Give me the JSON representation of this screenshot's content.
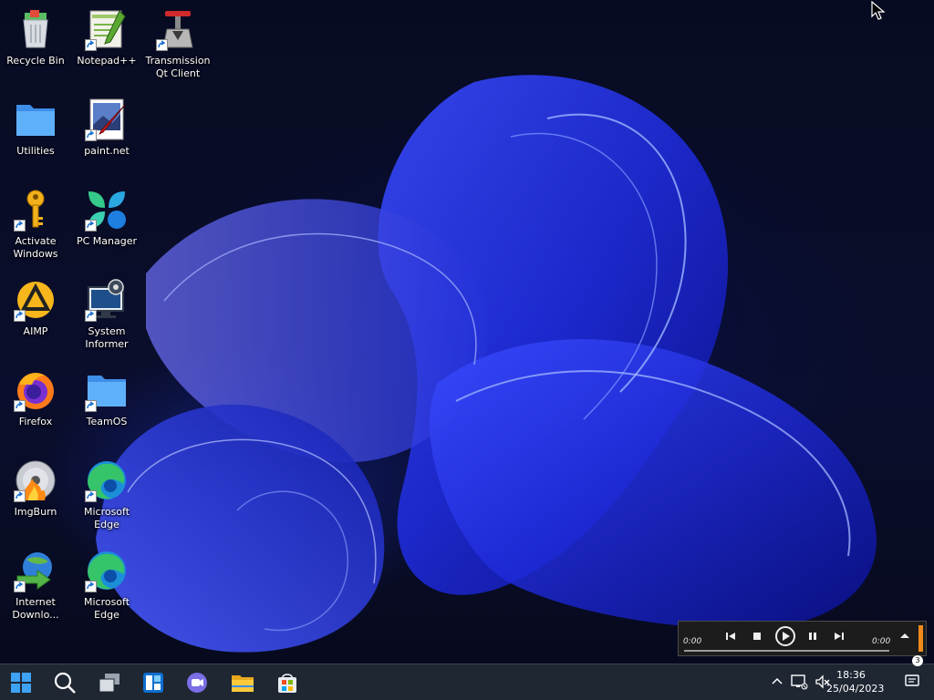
{
  "desktop_icons": [
    {
      "id": "recycle-bin",
      "label": "Recycle Bin",
      "icon": "recycle-bin-icon",
      "shortcut": false
    },
    {
      "id": "notepadpp",
      "label": "Notepad++",
      "icon": "notepadpp-icon",
      "shortcut": true
    },
    {
      "id": "transmission",
      "label": "Transmission\nQt Client",
      "icon": "transmission-icon",
      "shortcut": true
    },
    {
      "id": "utilities",
      "label": "Utilities",
      "icon": "folder-icon",
      "shortcut": false
    },
    {
      "id": "paintnet",
      "label": "paint.net",
      "icon": "paintnet-icon",
      "shortcut": true
    },
    {
      "id": "activate-windows",
      "label": "Activate\nWindows",
      "icon": "key-icon",
      "shortcut": true
    },
    {
      "id": "pc-manager",
      "label": "PC Manager",
      "icon": "pc-manager-icon",
      "shortcut": true
    },
    {
      "id": "aimp",
      "label": "AIMP",
      "icon": "aimp-icon",
      "shortcut": true
    },
    {
      "id": "system-informer",
      "label": "System\nInformer",
      "icon": "system-informer-icon",
      "shortcut": true
    },
    {
      "id": "firefox",
      "label": "Firefox",
      "icon": "firefox-icon",
      "shortcut": true
    },
    {
      "id": "teamos",
      "label": "TeamOS",
      "icon": "folder-icon",
      "shortcut": true
    },
    {
      "id": "imgburn",
      "label": "ImgBurn",
      "icon": "imgburn-disc-icon",
      "shortcut": true
    },
    {
      "id": "edge-1",
      "label": "Microsoft\nEdge",
      "icon": "edge-icon",
      "shortcut": true
    },
    {
      "id": "idm",
      "label": "Internet\nDownlo...",
      "icon": "internet-download-manager-icon",
      "shortcut": true
    },
    {
      "id": "edge-2",
      "label": "Microsoft\nEdge",
      "icon": "edge-icon",
      "shortcut": true
    }
  ],
  "media_bar": {
    "time_elapsed": "0:00",
    "time_total": "0:00",
    "controls": [
      "previous-icon",
      "stop-icon",
      "play-icon",
      "pause-icon",
      "next-icon",
      "eject-icon"
    ],
    "accent_color": "#f08a1c"
  },
  "taskbar": {
    "pinned": [
      "start-icon",
      "search-icon",
      "task-view-icon",
      "widgets-icon",
      "teams-chat-icon",
      "file-explorer-icon",
      "microsoft-store-icon"
    ],
    "tray": [
      "chevron-up-icon",
      "network-icon",
      "volume-muted-icon"
    ],
    "clock": {
      "time": "18:36",
      "date": "25/04/2023"
    },
    "notification_count": "3"
  },
  "colors": {
    "taskbar_bg": "#1f2733",
    "wallpaper_accent": "#2a3cff",
    "start_blue": "#3ea2f5"
  }
}
